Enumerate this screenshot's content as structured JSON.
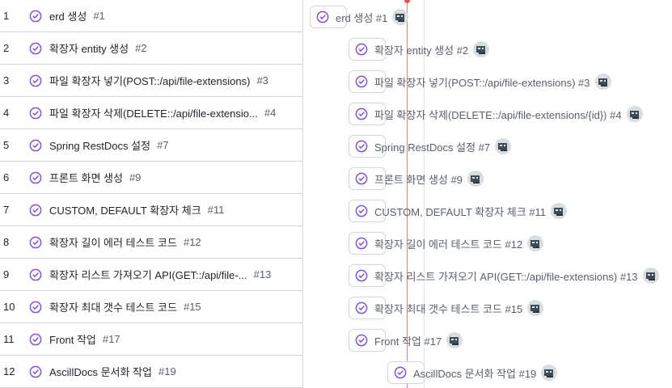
{
  "rows": [
    {
      "num": "1",
      "title": "erd 생성",
      "issue": "#1"
    },
    {
      "num": "2",
      "title": "확장자 entity 생성",
      "issue": "#2"
    },
    {
      "num": "3",
      "title": "파일 확장자 넣기(POST::/api/file-extensions)",
      "issue": "#3"
    },
    {
      "num": "4",
      "title": "파일 확장자 삭제(DELETE::/api/file-extensio...",
      "issue": "#4"
    },
    {
      "num": "5",
      "title": "Spring RestDocs 설정",
      "issue": "#7"
    },
    {
      "num": "6",
      "title": "프론트 화면 생성",
      "issue": "#9"
    },
    {
      "num": "7",
      "title": "CUSTOM, DEFAULT 확장자 체크",
      "issue": "#11"
    },
    {
      "num": "8",
      "title": "확장자 길이 에러 테스트 코드",
      "issue": "#12"
    },
    {
      "num": "9",
      "title": "확장자 리스트 가져오기 API(GET::/api/file-...",
      "issue": "#13"
    },
    {
      "num": "10",
      "title": "확장자 최대 갯수 테스트 코드",
      "issue": "#15"
    },
    {
      "num": "11",
      "title": "Front 작업",
      "issue": "#17"
    },
    {
      "num": "12",
      "title": "AscillDocs 문서화 작업",
      "issue": "#19"
    }
  ],
  "timeline": [
    {
      "label": "erd 생성 #1"
    },
    {
      "label": "확장자 entity 생성 #2"
    },
    {
      "label": "파일 확장자 넣기(POST::/api/file-extensions) #3"
    },
    {
      "label": "파일 확장자 삭제(DELETE::/api/file-extensions/{id}) #4"
    },
    {
      "label": "Spring RestDocs 설정 #7"
    },
    {
      "label": "프론트 화면 생성 #9"
    },
    {
      "label": "CUSTOM, DEFAULT 확장자 체크 #11"
    },
    {
      "label": "확장자 길이 에러 테스트 코드 #12"
    },
    {
      "label": "확장자 리스트 가져오기 API(GET::/api/file-extensions) #13"
    },
    {
      "label": "확장자 최대 갯수 테스트 코드 #15"
    },
    {
      "label": "Front 작업 #17"
    },
    {
      "label": "AscillDocs 문서화 작업 #19"
    }
  ],
  "colors": {
    "closed_icon": "#8250df",
    "today_marker": "#e5534b",
    "border": "#d0d7de"
  },
  "icons": {
    "status": "closed-issue-check-circle-icon",
    "assignee": "assignee-avatar"
  }
}
